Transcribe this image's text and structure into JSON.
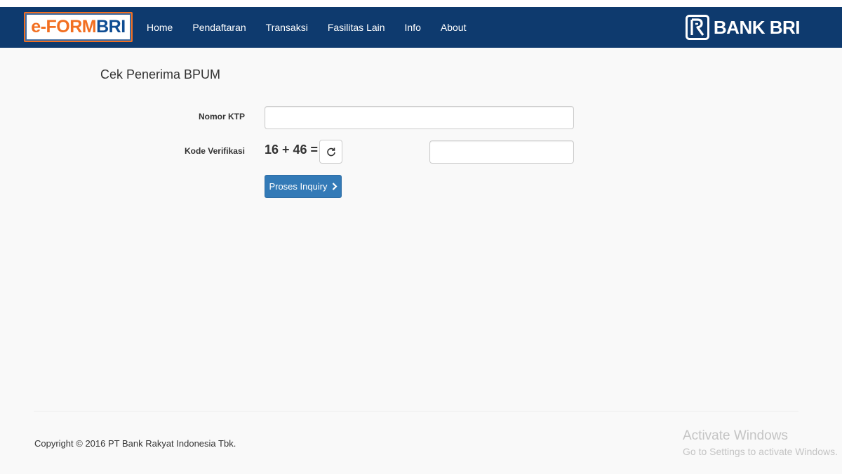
{
  "header": {
    "logo_left": {
      "part1": "e-FORM",
      "part2": "BRI"
    },
    "nav_items": [
      "Home",
      "Pendaftaran",
      "Transaksi",
      "Fasilitas Lain",
      "Info",
      "About"
    ],
    "brand_right": "BANK BRI"
  },
  "main": {
    "title": "Cek Penerima BPUM",
    "form": {
      "ktp_label": "Nomor KTP",
      "ktp_value": "",
      "verification_label": "Kode Verifikasi",
      "captcha_question": "16 + 46 =",
      "captcha_answer": "",
      "submit_label": "Proses Inquiry",
      "refresh_icon": "refresh-icon",
      "submit_icon": "chevron-right-icon"
    }
  },
  "footer": {
    "copyright": "Copyright © 2016  PT Bank Rakyat Indonesia Tbk."
  },
  "watermark": {
    "title": "Activate Windows",
    "subtitle": "Go to Settings to activate Windows."
  },
  "colors": {
    "navbar": "#0e3a6e",
    "logo_orange": "#f26f21",
    "logo_blue": "#0e4c92",
    "button_primary": "#337ab7"
  }
}
